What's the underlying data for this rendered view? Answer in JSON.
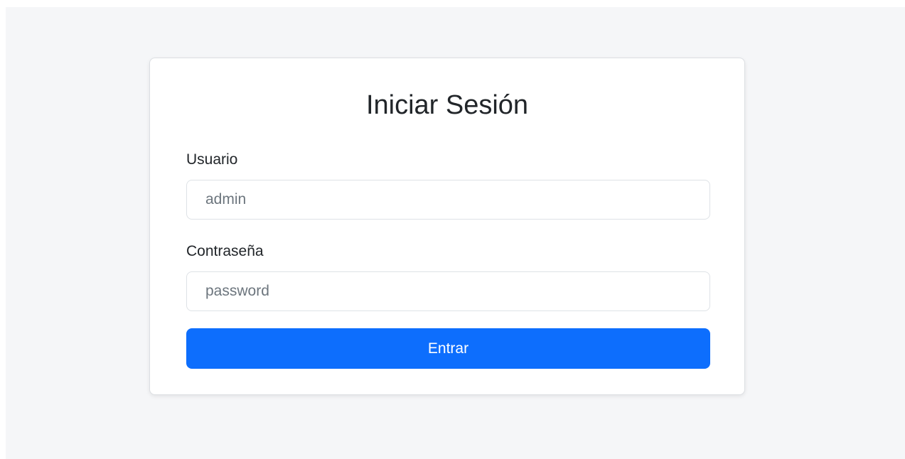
{
  "login": {
    "title": "Iniciar Sesión",
    "username": {
      "label": "Usuario",
      "placeholder": "admin",
      "value": ""
    },
    "password": {
      "label": "Contraseña",
      "placeholder": "password",
      "value": ""
    },
    "submit_label": "Entrar"
  },
  "colors": {
    "page_background": "#f5f6f8",
    "card_background": "#ffffff",
    "primary_button": "#0d6efd",
    "button_text": "#ffffff",
    "text": "#212529",
    "placeholder_text": "#6c757d",
    "input_border": "#dee2e6"
  }
}
